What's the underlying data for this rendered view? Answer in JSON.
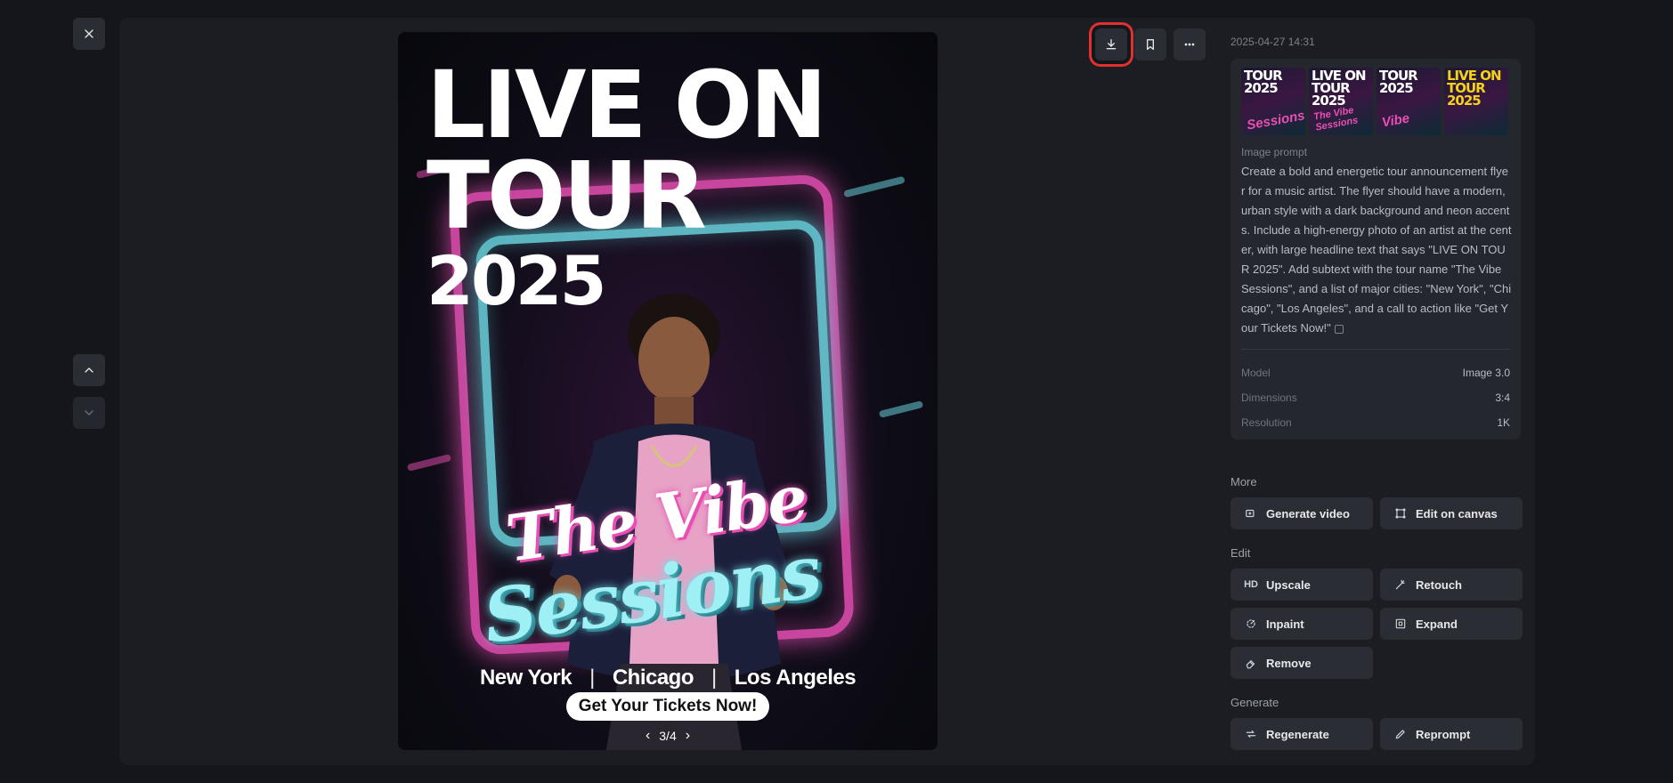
{
  "viewer": {
    "close_icon": "close-icon",
    "nav": {
      "up_icon": "chevron-up-icon",
      "down_icon": "chevron-down-icon"
    }
  },
  "poster": {
    "headline_line1": "LIVE ON",
    "headline_line2": "TOUR",
    "headline_line3": "2025",
    "script_line1": "The Vibe",
    "script_line2": "Sessions",
    "cities": [
      "New York",
      "Chicago",
      "Los Angeles"
    ],
    "separator": "|",
    "cta": "Get Your Tickets Now!",
    "pager": {
      "current": "3/4",
      "prev_icon": "chevron-left-icon",
      "next_icon": "chevron-right-icon"
    },
    "colors": {
      "neon_pink": "#e84fb4",
      "neon_cyan": "#6fe0ea"
    }
  },
  "actions": {
    "download_icon": "download-icon",
    "bookmark_icon": "bookmark-icon",
    "more_icon": "more-horizontal-icon",
    "highlight_color": "#e0302f"
  },
  "details": {
    "timestamp": "2025-04-27 14:31",
    "thumbnails": [
      {
        "title": "TOUR 2025",
        "script": "Sessions"
      },
      {
        "title": "LIVE ON TOUR 2025",
        "script": "The Vibe Sessions"
      },
      {
        "title": "TOUR 2025",
        "script": "Vibe"
      },
      {
        "title": "LIVE ON TOUR 2025",
        "script": ""
      }
    ],
    "prompt_label": "Image prompt",
    "prompt_text": "Create a bold and energetic tour announcement flyer for a music artist. The flyer should have a modern, urban style with a dark background and neon accents. Include a high-energy photo of an artist at the center, with large headline text that says \"LIVE ON TOUR 2025\". Add subtext with the tour name \"The Vibe Sessions\", and a list of major cities: \"New York\", \"Chicago\", \"Los Angeles\", and a call to action like \"Get Your Tickets Now!\"",
    "meta": [
      {
        "key": "Model",
        "value": "Image 3.0"
      },
      {
        "key": "Dimensions",
        "value": "3:4"
      },
      {
        "key": "Resolution",
        "value": "1K"
      }
    ]
  },
  "sections": {
    "more": {
      "label": "More",
      "buttons": [
        {
          "label": "Generate video",
          "icon": "video-plus-icon"
        },
        {
          "label": "Edit on canvas",
          "icon": "canvas-edit-icon"
        }
      ]
    },
    "edit": {
      "label": "Edit",
      "buttons": [
        {
          "label": "Upscale",
          "icon": "hd-icon",
          "icon_text": "HD"
        },
        {
          "label": "Retouch",
          "icon": "magic-wand-icon"
        },
        {
          "label": "Inpaint",
          "icon": "inpaint-icon"
        },
        {
          "label": "Expand",
          "icon": "expand-icon"
        },
        {
          "label": "Remove",
          "icon": "eraser-icon"
        }
      ]
    },
    "generate": {
      "label": "Generate",
      "buttons": [
        {
          "label": "Regenerate",
          "icon": "regenerate-icon"
        },
        {
          "label": "Reprompt",
          "icon": "pencil-icon"
        }
      ]
    }
  }
}
